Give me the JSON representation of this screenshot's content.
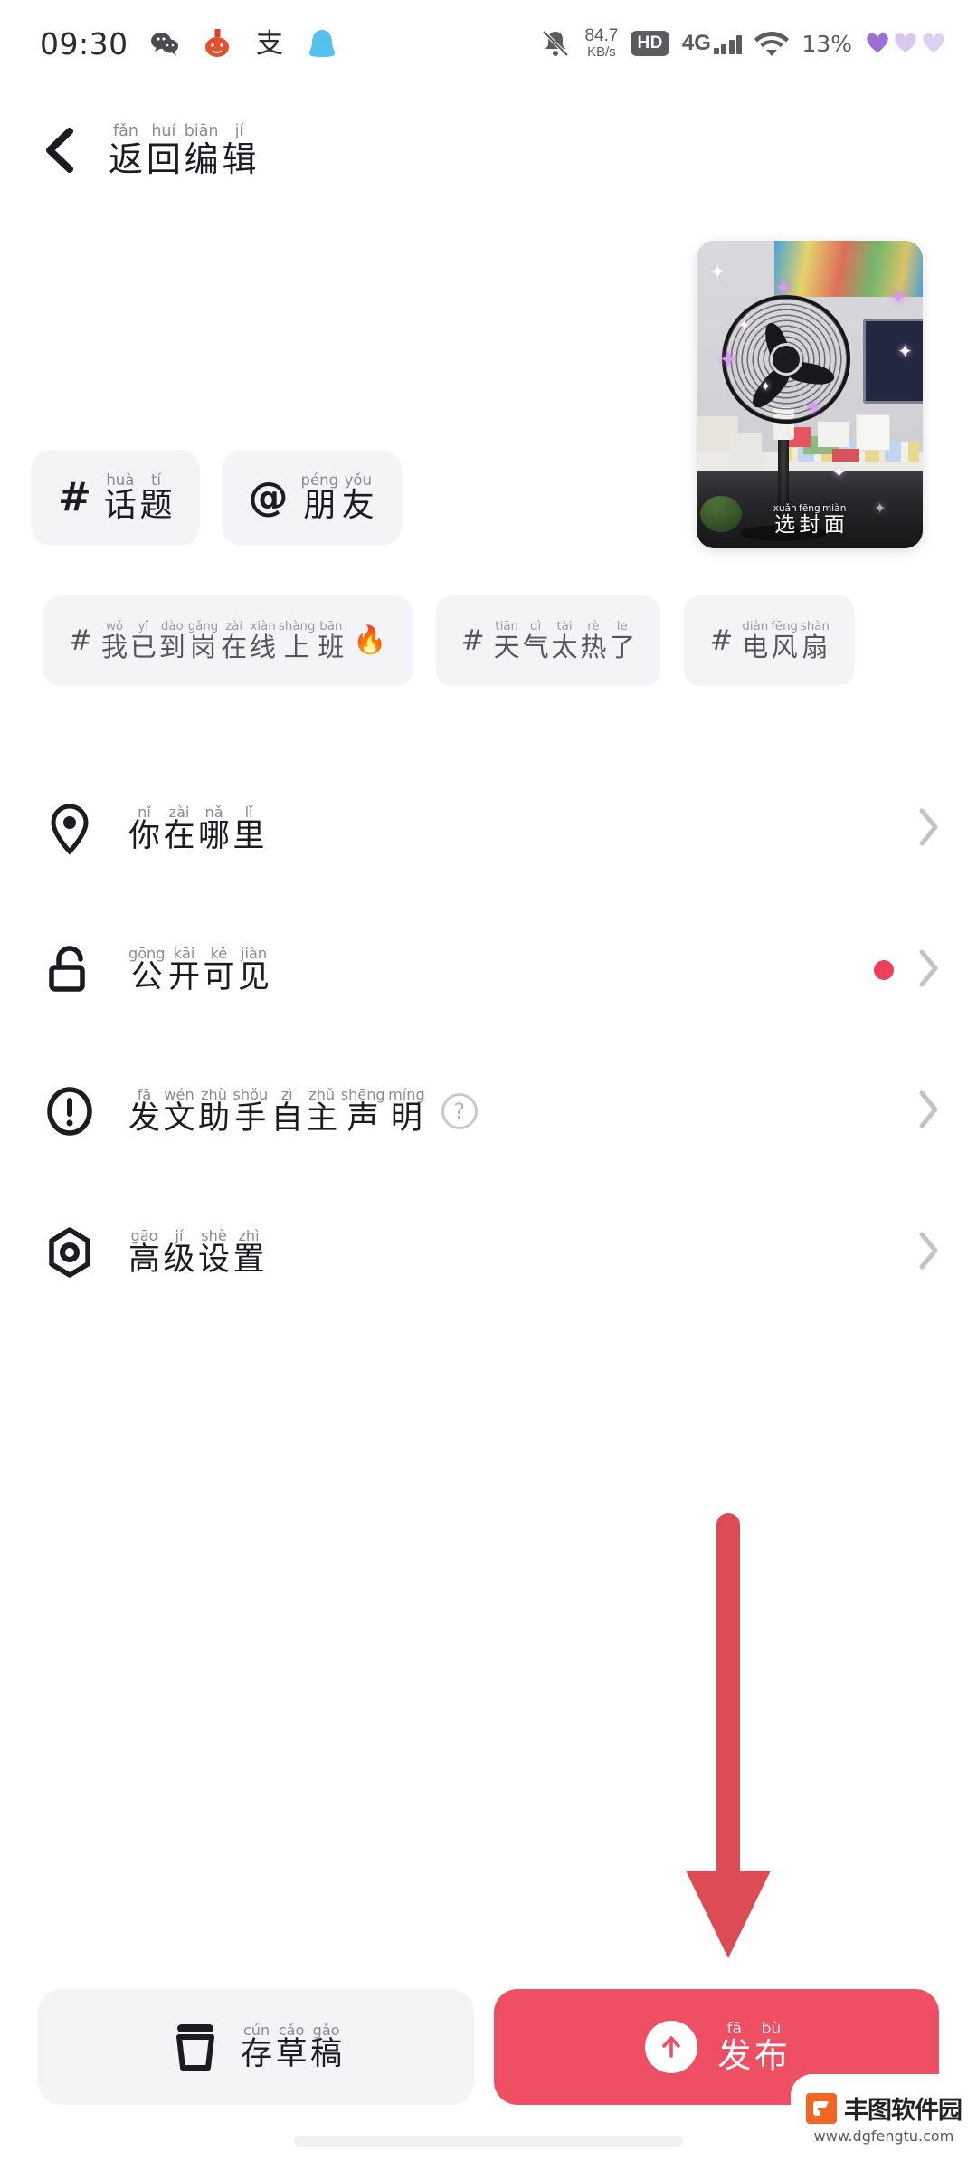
{
  "statusbar": {
    "time": "09:30",
    "apps": [
      "wechat-icon",
      "app-icon",
      "alipay-icon",
      "qq-icon"
    ],
    "alipay_glyph": "支",
    "mute_icon": "bell-muted-icon",
    "netspeed_value": "84.7",
    "netspeed_unit": "KB/s",
    "hd_label": "HD",
    "network_label": "4G",
    "signal_bars": 4,
    "wifi_icon": "wifi-icon",
    "battery": "13%",
    "hearts": 3,
    "heart_colors": [
      "#9b6fd4",
      "#d8c7f0",
      "#ded0f2"
    ]
  },
  "navbar": {
    "back_icon": "back-chevron-icon",
    "title_pinyin": [
      "fǎn",
      "huí",
      "biān",
      "jí"
    ],
    "title_hanzi": [
      "返",
      "回",
      "编",
      "辑"
    ]
  },
  "cover": {
    "label_pinyin": [
      "xuǎn",
      "fēng",
      "miàn"
    ],
    "label_hanzi": [
      "选",
      "封",
      "面"
    ],
    "alt": "room-with-electric-fan-thumbnail"
  },
  "tag_buttons": [
    {
      "symbol": "#",
      "pinyin": [
        "huà",
        "tí"
      ],
      "hanzi": [
        "话",
        "题"
      ],
      "name": "topic"
    },
    {
      "symbol": "@",
      "pinyin": [
        "péng",
        "yǒu"
      ],
      "hanzi": [
        "朋",
        "友"
      ],
      "name": "friend"
    }
  ],
  "topic_chips": [
    {
      "hash": "#",
      "pinyin": [
        "wǒ",
        "yǐ",
        "dào",
        "gǎng",
        "zài",
        "xiàn",
        "shàng",
        "bān"
      ],
      "hanzi": [
        "我",
        "已",
        "到",
        "岗",
        "在",
        "线",
        "上",
        "班"
      ],
      "flame": "🔥",
      "hot": true
    },
    {
      "hash": "#",
      "pinyin": [
        "tiān",
        "qì",
        "tài",
        "rè",
        "le"
      ],
      "hanzi": [
        "天",
        "气",
        "太",
        "热",
        "了"
      ],
      "hot": false
    },
    {
      "hash": "#",
      "pinyin": [
        "diàn",
        "fēng",
        "shàn"
      ],
      "hanzi": [
        "电",
        "风",
        "扇"
      ],
      "hot": false
    }
  ],
  "list_rows": [
    {
      "icon": "location-pin-icon",
      "pinyin": [
        "nǐ",
        "zài",
        "nǎ",
        "lǐ"
      ],
      "hanzi": [
        "你",
        "在",
        "哪",
        "里"
      ],
      "help": false,
      "dot": false,
      "chevron": "›"
    },
    {
      "icon": "unlock-icon",
      "pinyin": [
        "gōng",
        "kāi",
        "kě",
        "jiàn"
      ],
      "hanzi": [
        "公",
        "开",
        "可",
        "见"
      ],
      "help": false,
      "dot": true,
      "chevron": "›"
    },
    {
      "icon": "exclamation-circle-icon",
      "pinyin": [
        "fā",
        "wén",
        "zhù",
        "shǒu",
        "zì",
        "zhǔ",
        "shēng",
        "míng"
      ],
      "hanzi": [
        "发",
        "文",
        "助",
        "手",
        "自",
        "主",
        "声",
        "明"
      ],
      "help": true,
      "help_glyph": "?",
      "dot": false,
      "chevron": "›"
    },
    {
      "icon": "settings-hexagon-icon",
      "pinyin": [
        "gāo",
        "jí",
        "shè",
        "zhì"
      ],
      "hanzi": [
        "高",
        "级",
        "设",
        "置"
      ],
      "help": false,
      "dot": false,
      "chevron": "›"
    }
  ],
  "annotation": {
    "type": "down-arrow",
    "color": "#dd4b55"
  },
  "bottom_bar": {
    "draft": {
      "icon": "save-draft-icon",
      "pinyin": [
        "cún",
        "cǎo",
        "gǎo"
      ],
      "hanzi": [
        "存",
        "草",
        "稿"
      ]
    },
    "publish": {
      "icon": "upload-arrow-icon",
      "pinyin": [
        "fā",
        "bù"
      ],
      "hanzi": [
        "发",
        "布"
      ],
      "color": "#ef4f63"
    }
  },
  "watermark": {
    "name": "丰图软件园",
    "url": "www.dgfengtu.com",
    "logo_color": "#f26522"
  }
}
